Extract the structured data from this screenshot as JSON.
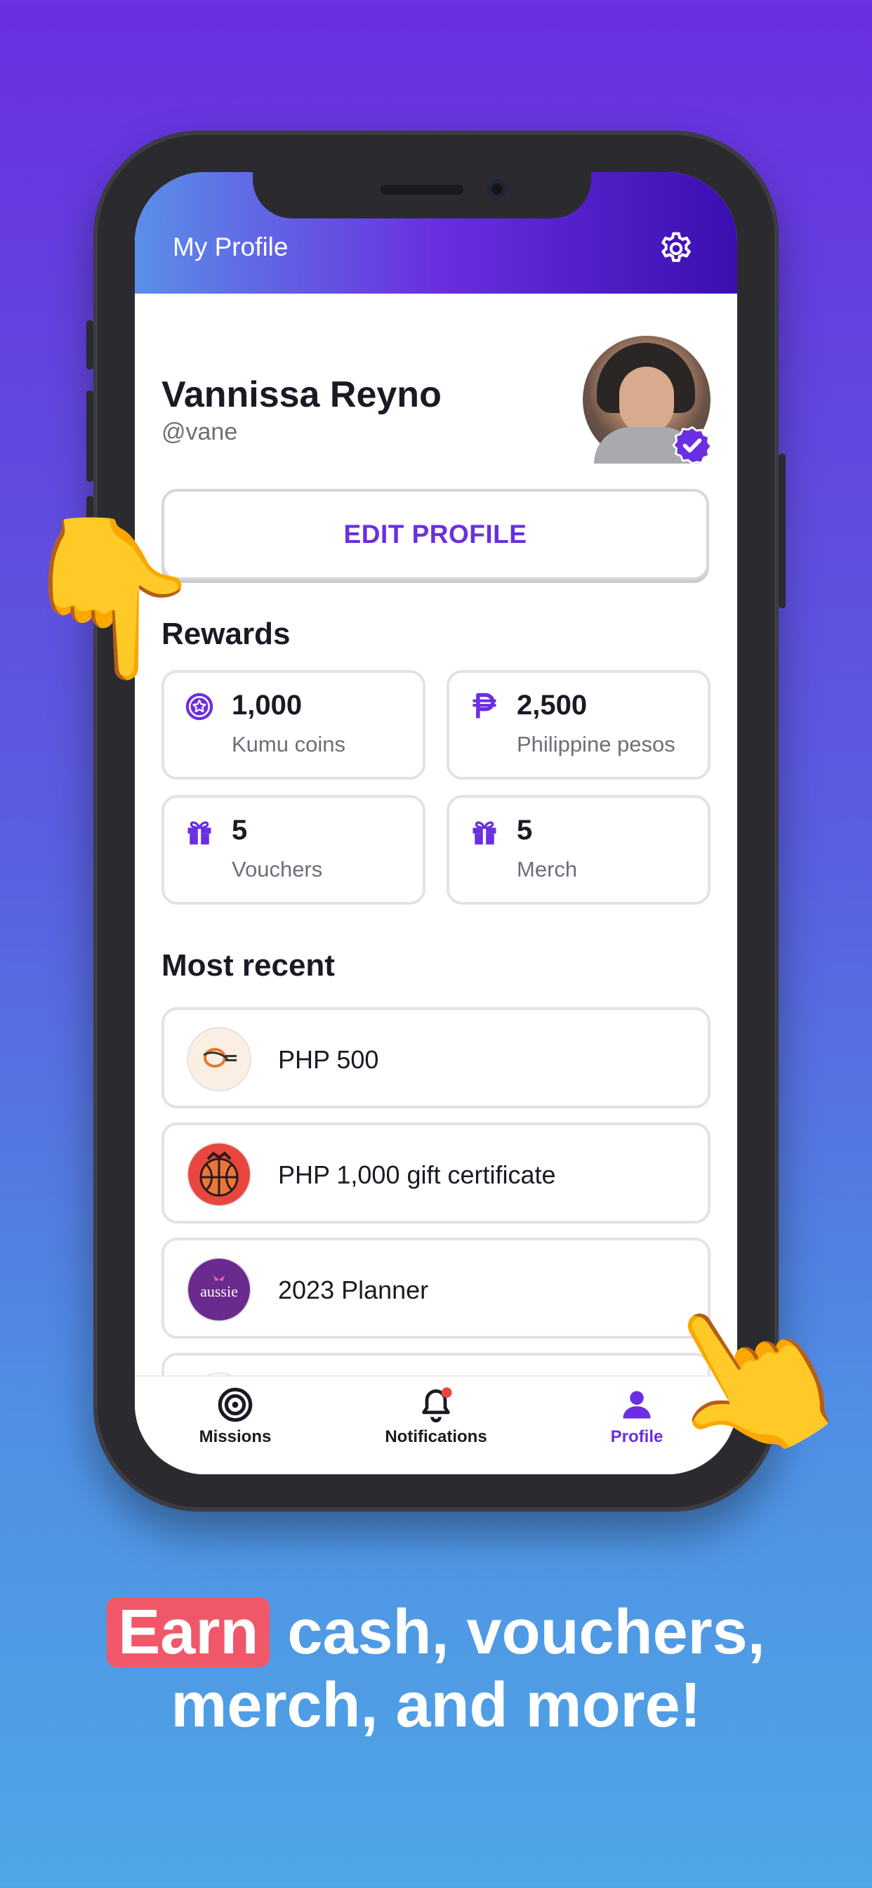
{
  "header": {
    "title": "My Profile",
    "settings_icon": "gear-icon"
  },
  "profile": {
    "name": "Vannissa Reyno",
    "handle": "@vane",
    "verified_icon": "verified-badge-icon"
  },
  "edit_button": {
    "label": "EDIT PROFILE"
  },
  "rewards": {
    "title": "Rewards",
    "cards": [
      {
        "value": "1,000",
        "label": "Kumu coins",
        "icon": "coin-icon"
      },
      {
        "value": "2,500",
        "label": "Philippine pesos",
        "icon": "peso-icon"
      },
      {
        "value": "5",
        "label": "Vouchers",
        "icon": "gift-icon"
      },
      {
        "value": "5",
        "label": "Merch",
        "icon": "gift-icon"
      }
    ]
  },
  "recent": {
    "title": "Most recent",
    "items": [
      {
        "text": "PHP 500",
        "logo": "coffee-brand-logo"
      },
      {
        "text": "PHP 1,000 gift certificate",
        "logo": "basketball-brand-logo"
      },
      {
        "text": "2023 Planner",
        "logo": "aussie-logo",
        "logo_text": "aussie"
      }
    ]
  },
  "tabbar": {
    "tabs": [
      {
        "label": "Missions",
        "icon": "target-icon",
        "active": false
      },
      {
        "label": "Notifications",
        "icon": "bell-icon",
        "active": false,
        "has_badge": true
      },
      {
        "label": "Profile",
        "icon": "person-icon",
        "active": true
      }
    ]
  },
  "promo": {
    "highlight": "Earn",
    "rest_line1": "cash, vouchers,",
    "line2": "merch, and more!"
  },
  "colors": {
    "accent": "#6a2fe0",
    "highlight": "#f0586a",
    "badge": "#e8463e"
  }
}
